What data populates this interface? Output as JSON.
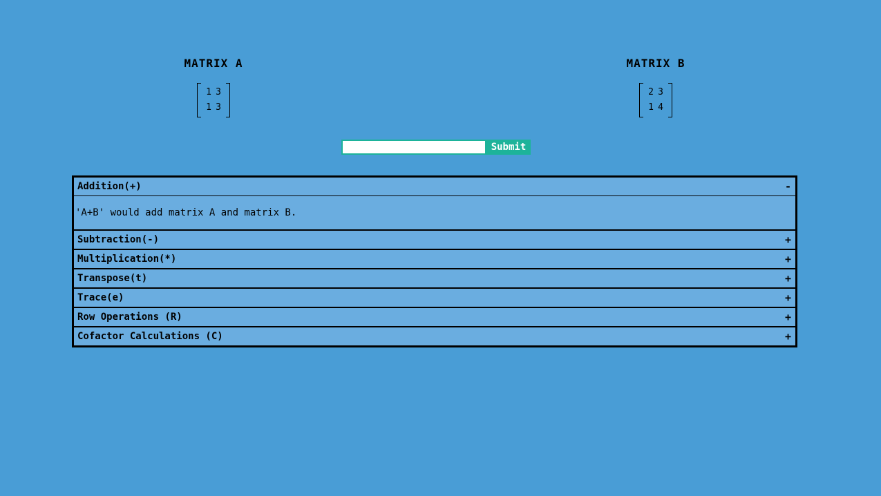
{
  "matrix_a": {
    "title": "MATRIX A",
    "rows": [
      [
        "1",
        "3"
      ],
      [
        "1",
        "3"
      ]
    ]
  },
  "matrix_b": {
    "title": "MATRIX B",
    "rows": [
      [
        "2",
        "3"
      ],
      [
        "1",
        "4"
      ]
    ]
  },
  "command": {
    "value": "",
    "placeholder": "",
    "submit_label": "Submit"
  },
  "colors": {
    "background": "#499dd6",
    "panel": "#6aade0",
    "accent": "#1db39a"
  },
  "operations": [
    {
      "label": "Addition(+)",
      "toggle": "-",
      "expanded": true,
      "description": "'A+B' would add matrix A and matrix B."
    },
    {
      "label": "Subtraction(-)",
      "toggle": "+",
      "expanded": false
    },
    {
      "label": "Multiplication(*)",
      "toggle": "+",
      "expanded": false
    },
    {
      "label": "Transpose(t)",
      "toggle": "+",
      "expanded": false
    },
    {
      "label": "Trace(e)",
      "toggle": "+",
      "expanded": false
    },
    {
      "label": "Row Operations (R)",
      "toggle": "+",
      "expanded": false
    },
    {
      "label": "Cofactor Calculations (C)",
      "toggle": "+",
      "expanded": false
    }
  ]
}
